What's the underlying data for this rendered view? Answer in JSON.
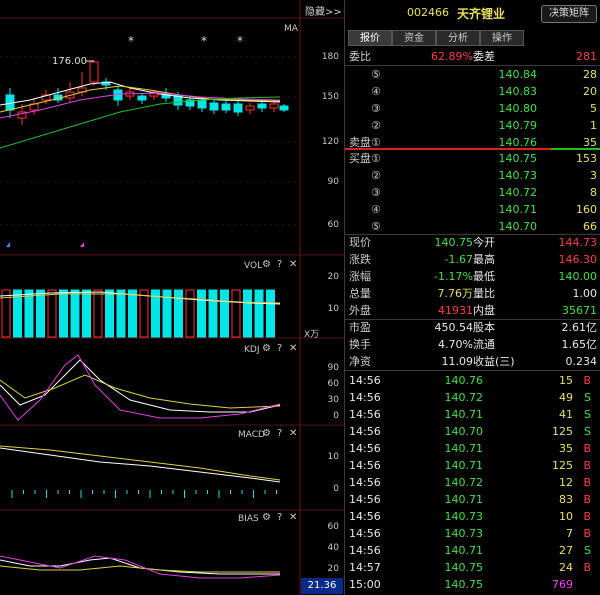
{
  "chart": {
    "hide_label": "隐藏>>",
    "ma_label": "MA",
    "price_annotation": "176.00",
    "price_axis": [
      "180",
      "150",
      "120",
      "90",
      "60"
    ],
    "vol_title": "VOL",
    "vol_axis": [
      "20",
      "10"
    ],
    "vol_unit": "X万",
    "kdj_title": "KDJ",
    "kdj_axis": [
      "90",
      "60",
      "30",
      "0"
    ],
    "macd_title": "MACD",
    "macd_axis": [
      "10",
      "0"
    ],
    "bias_title": "BIAS",
    "bias_axis": [
      "60",
      "40",
      "20"
    ],
    "bias_value": "21.36",
    "stars": [
      "*",
      "*",
      "*"
    ],
    "colors": {
      "up": "#ff3030",
      "down": "#00e5e5",
      "ma5": "#ffffff",
      "ma10": "#e0d040",
      "ma20": "#e040e0",
      "ma60": "#20c020"
    }
  },
  "header": {
    "code": "002466",
    "name": "天齐锂业",
    "matrix_button": "决策矩阵"
  },
  "tabs": [
    "报价",
    "资金",
    "分析",
    "操作"
  ],
  "weibi": {
    "label": "委比",
    "pct": "62.89%",
    "diff_label": "委差",
    "diff": "281"
  },
  "asks": [
    {
      "label": "⑤",
      "price": "140.84",
      "vol": "28"
    },
    {
      "label": "④",
      "price": "140.83",
      "vol": "20"
    },
    {
      "label": "③",
      "price": "140.80",
      "vol": "5"
    },
    {
      "label": "②",
      "price": "140.79",
      "vol": "1"
    },
    {
      "label": "卖盘①",
      "price": "140.76",
      "vol": "35"
    }
  ],
  "bids": [
    {
      "label": "买盘①",
      "price": "140.75",
      "vol": "153"
    },
    {
      "label": "②",
      "price": "140.73",
      "vol": "3"
    },
    {
      "label": "③",
      "price": "140.72",
      "vol": "8"
    },
    {
      "label": "④",
      "price": "140.71",
      "vol": "160"
    },
    {
      "label": "⑤",
      "price": "140.70",
      "vol": "66"
    }
  ],
  "quote": [
    {
      "l1": "现价",
      "v1": "140.75",
      "c1": "green",
      "l2": "今开",
      "v2": "144.73",
      "c2": "red"
    },
    {
      "l1": "涨跌",
      "v1": "-1.67",
      "c1": "green",
      "l2": "最高",
      "v2": "146.30",
      "c2": "red"
    },
    {
      "l1": "涨幅",
      "v1": "-1.17%",
      "c1": "green",
      "l2": "最低",
      "v2": "140.00",
      "c2": "green"
    },
    {
      "l1": "总量",
      "v1": "7.76万",
      "c1": "yellow",
      "l2": "量比",
      "v2": "1.00",
      "c2": "white"
    },
    {
      "l1": "外盘",
      "v1": "41931",
      "c1": "red",
      "l2": "内盘",
      "v2": "35671",
      "c2": "green"
    },
    {
      "l1": "市盈",
      "v1": "450.54",
      "c1": "white",
      "l2": "股本",
      "v2": "2.61亿",
      "c2": "white"
    },
    {
      "l1": "换手",
      "v1": "4.70%",
      "c1": "white",
      "l2": "流通",
      "v2": "1.65亿",
      "c2": "white"
    },
    {
      "l1": "净资",
      "v1": "11.09",
      "c1": "white",
      "l2": "收益(三)",
      "v2": "0.234",
      "c2": "white"
    }
  ],
  "trades": [
    {
      "time": "14:56",
      "price": "140.76",
      "vol": "15",
      "side": "B"
    },
    {
      "time": "14:56",
      "price": "140.72",
      "vol": "49",
      "side": "S"
    },
    {
      "time": "14:56",
      "price": "140.71",
      "vol": "41",
      "side": "S"
    },
    {
      "time": "14:56",
      "price": "140.70",
      "vol": "125",
      "side": "S"
    },
    {
      "time": "14:56",
      "price": "140.71",
      "vol": "35",
      "side": "B"
    },
    {
      "time": "14:56",
      "price": "140.71",
      "vol": "125",
      "side": "B"
    },
    {
      "time": "14:56",
      "price": "140.72",
      "vol": "12",
      "side": "B"
    },
    {
      "time": "14:56",
      "price": "140.71",
      "vol": "83",
      "side": "B"
    },
    {
      "time": "14:56",
      "price": "140.73",
      "vol": "10",
      "side": "B"
    },
    {
      "time": "14:56",
      "price": "140.73",
      "vol": "7",
      "side": "B"
    },
    {
      "time": "14:56",
      "price": "140.71",
      "vol": "27",
      "side": "S"
    },
    {
      "time": "14:57",
      "price": "140.75",
      "vol": "24",
      "side": "B"
    },
    {
      "time": "15:00",
      "price": "140.75",
      "vol": "769",
      "side": ""
    }
  ]
}
